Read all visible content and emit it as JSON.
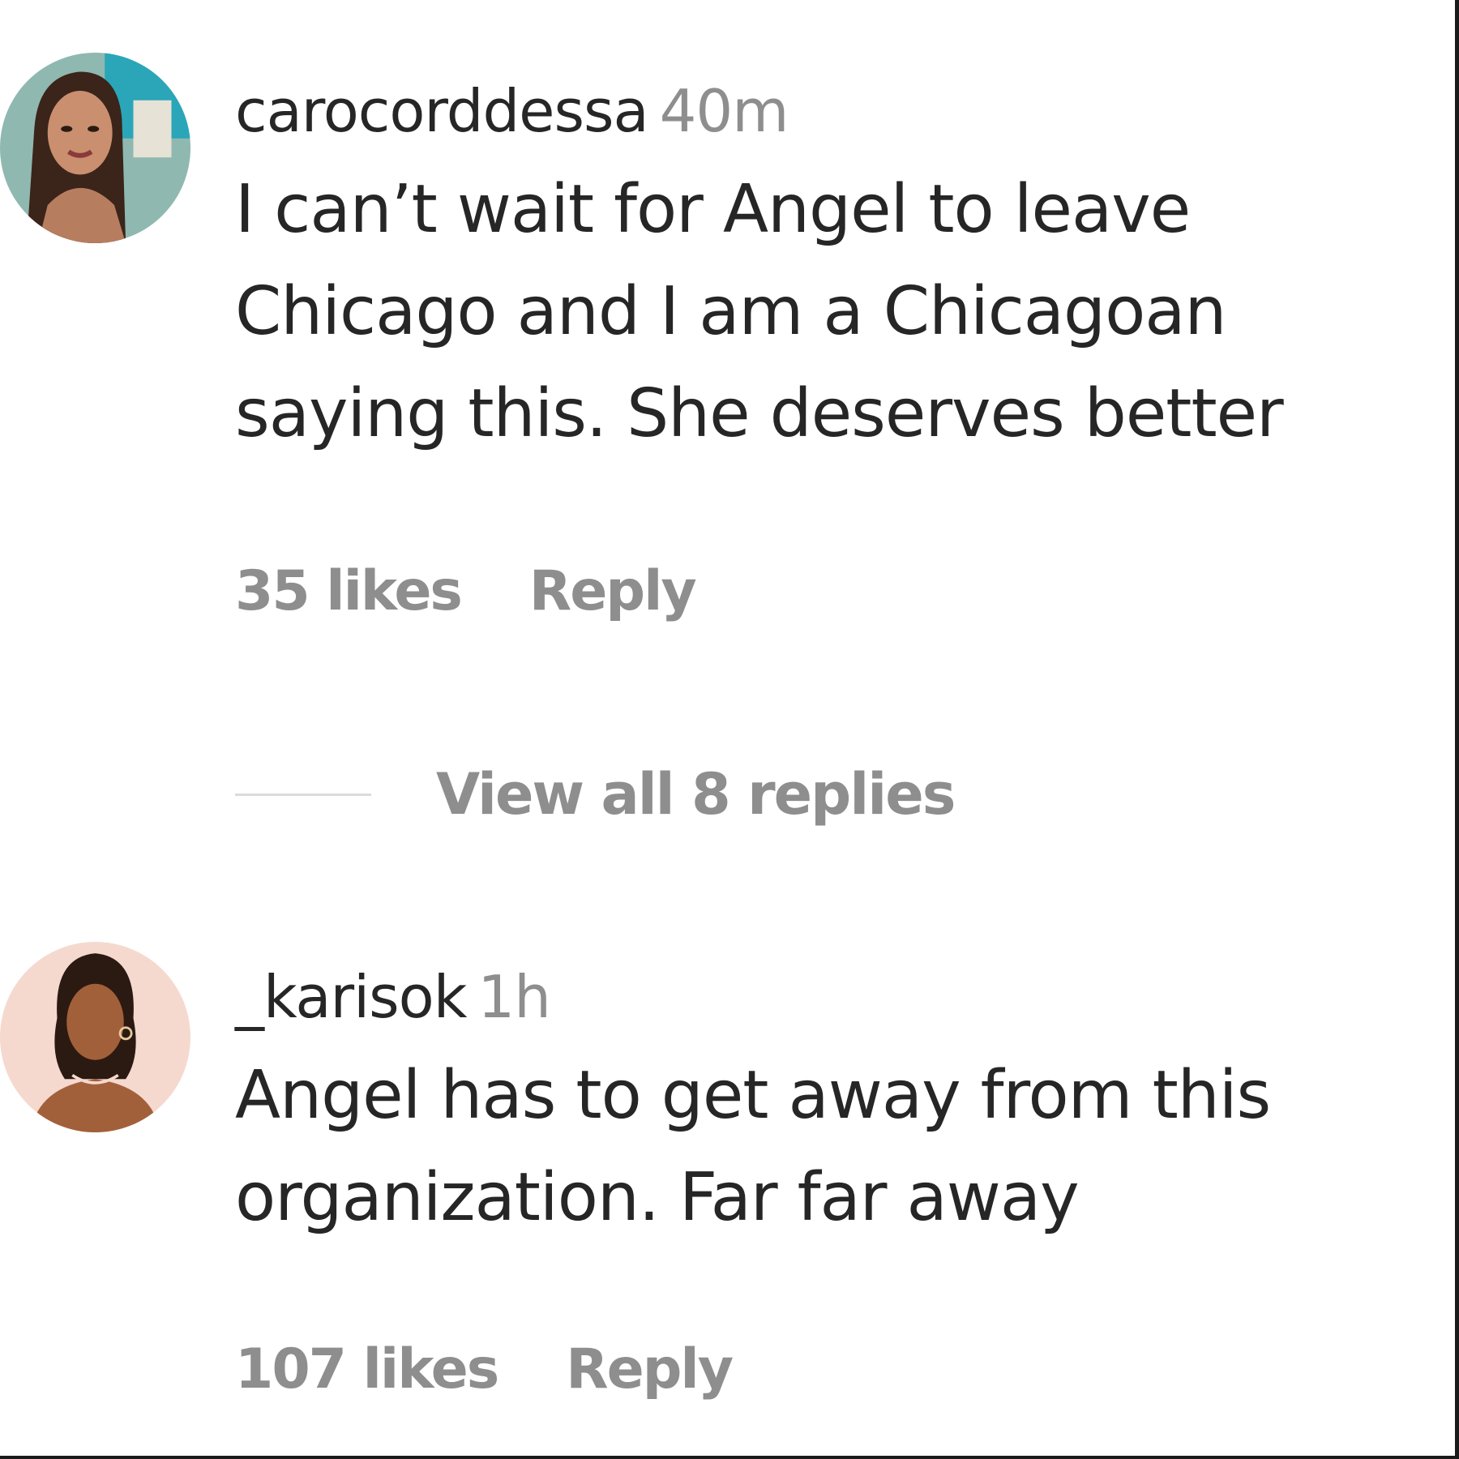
{
  "comments": [
    {
      "username": "carocorddessa",
      "timestamp": "40m",
      "lines": [
        "I can’t wait for Angel to leave",
        "Chicago and I am a Chicagoan",
        "saying this. She deserves better"
      ],
      "likes_label": "35 likes",
      "reply_label": "Reply",
      "avatar_icon": "profile-photo-icon"
    },
    {
      "username": "_karisok",
      "timestamp": "1h",
      "lines": [
        "Angel has to get away from this",
        "organization. Far far away"
      ],
      "likes_label": "107 likes",
      "reply_label": "Reply",
      "avatar_icon": "illustrated-avatar-icon"
    }
  ],
  "view_replies_label": "View all 8 replies",
  "colors": {
    "text_primary": "#262626",
    "text_secondary": "#8e8e8e",
    "divider": "#dbdbdb",
    "background": "#ffffff"
  }
}
